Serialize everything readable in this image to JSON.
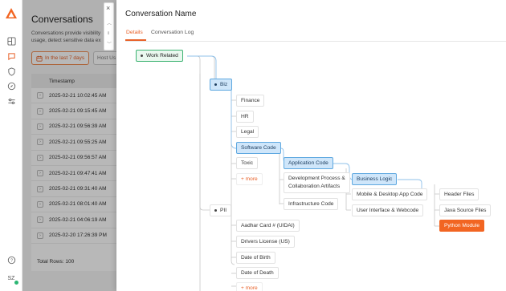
{
  "rail": {
    "icons": [
      "logo-icon",
      "grid-icon",
      "chat-icon",
      "shield-icon",
      "compass-icon",
      "sliders-icon",
      "help-icon"
    ],
    "user_initials": "SZ"
  },
  "background": {
    "title": "Conversations",
    "description": "Conversations provide visibility\nusage, detect sensitive data ex",
    "filter_label": "In the last 7 days",
    "host_filter": "Host Us",
    "table_header": "Timestamp",
    "rows": [
      "2025-02-21 10:02:45 AM",
      "2025-02-21 09:15:45 AM",
      "2025-02-21 09:56:39 AM",
      "2025-02-21 09:55:25 AM",
      "2025-02-21 09:56:57 AM",
      "2025-02-21 09:47:41 AM",
      "2025-02-21 09:31:40 AM",
      "2025-02-21 08:01:40 AM",
      "2025-02-21 04:06:19 AM",
      "2025-02-20 17:26:39 PM"
    ],
    "total_rows": "Total Rows: 100"
  },
  "drawer": {
    "title": "Conversation Name",
    "tabs": [
      "Details",
      "Conversation Log"
    ],
    "active_tab": "Details"
  },
  "tree": {
    "work_related": "Work Related",
    "biz": "Biz",
    "finance": "Finance",
    "hr": "HR",
    "legal": "Legal",
    "software_code": "Software Code",
    "toxic": "Toxic",
    "more1": "+ more",
    "application_code": "Application Code",
    "dev_process_1": "Development Process &",
    "dev_process_2": "Collaboration Artifacts",
    "infrastructure_code": "Infrastructure Code",
    "business_logic": "Business Logic",
    "mobile_desktop": "Mobile & Desktop App Code",
    "ui_webcode": "User Interface & Webcode",
    "header_files": "Header Files",
    "java_source": "Java Source Files",
    "python_module": "Python Module",
    "pii": "PII",
    "aadhar": "Aadhar Card # (UIDAI)",
    "drivers_license": "Drivers License (US)",
    "dob": "Date of Birth",
    "dod": "Date of Death",
    "more2": "+ more"
  },
  "colors": {
    "accent": "#e8622a",
    "selected_node": "#cfe6fa",
    "root_node": "#eaf8ef",
    "highlight_node": "#f26522"
  }
}
